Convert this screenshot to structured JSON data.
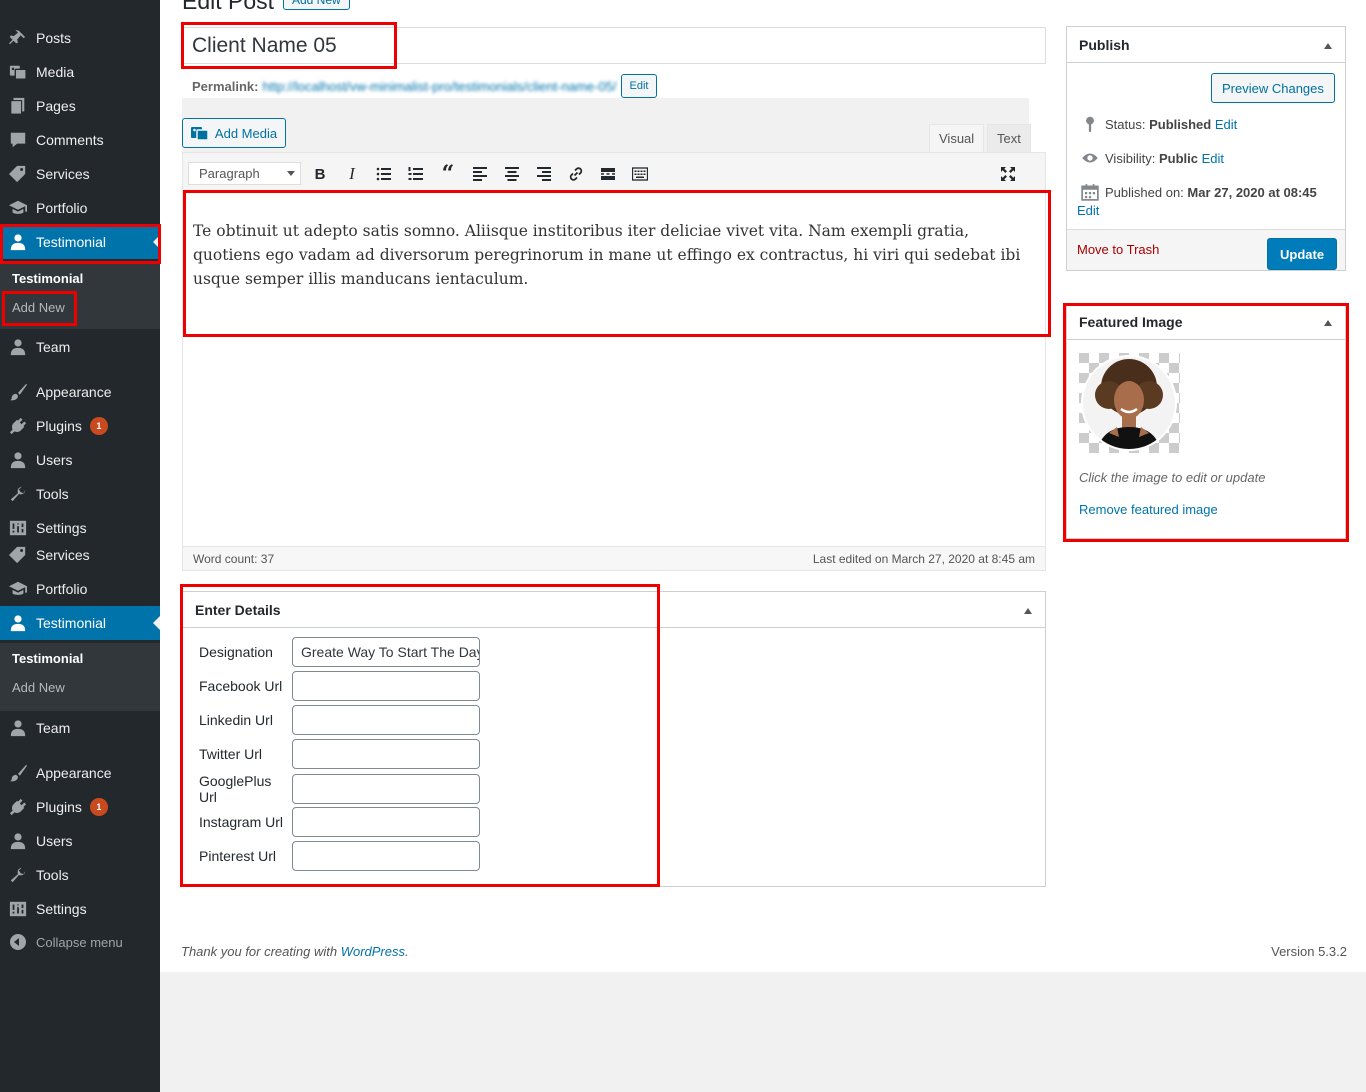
{
  "menu": {
    "group1": [
      {
        "label": "Posts",
        "icon": "pin-icon"
      },
      {
        "label": "Media",
        "icon": "media-icon"
      },
      {
        "label": "Pages",
        "icon": "pages-icon"
      },
      {
        "label": "Comments",
        "icon": "comment-icon"
      },
      {
        "label": "Services",
        "icon": "tag-icon"
      },
      {
        "label": "Portfolio",
        "icon": "portfolio-icon"
      },
      {
        "label": "Testimonial",
        "icon": "user-icon"
      }
    ],
    "submenu1": {
      "title": "Testimonial",
      "add_new": "Add New"
    },
    "group2": [
      {
        "label": "Team",
        "icon": "user-icon"
      },
      {
        "label": "Appearance",
        "icon": "brush-icon"
      },
      {
        "label": "Plugins",
        "icon": "plugin-icon",
        "badge": "1"
      },
      {
        "label": "Users",
        "icon": "user-icon"
      },
      {
        "label": "Tools",
        "icon": "wrench-icon"
      },
      {
        "label": "Settings",
        "icon": "settings-icon"
      },
      {
        "label": "Services",
        "icon": "tag-icon"
      },
      {
        "label": "Portfolio",
        "icon": "portfolio-icon"
      },
      {
        "label": "Testimonial",
        "icon": "user-icon"
      }
    ],
    "submenu2": {
      "title": "Testimonial",
      "add_new": "Add New"
    },
    "group3": [
      {
        "label": "Team",
        "icon": "user-icon"
      },
      {
        "label": "Appearance",
        "icon": "brush-icon"
      },
      {
        "label": "Plugins",
        "icon": "plugin-icon",
        "badge": "1"
      },
      {
        "label": "Users",
        "icon": "user-icon"
      },
      {
        "label": "Tools",
        "icon": "wrench-icon"
      },
      {
        "label": "Settings",
        "icon": "settings-icon"
      }
    ],
    "collapse": "Collapse menu"
  },
  "page": {
    "heading": "Edit Post",
    "add_new": "Add New",
    "title_value": "Client Name 05",
    "permalink_label": "Permalink:",
    "permalink_url": "http://localhost/vw-minimalist-pro/testimonials/client-name-05/",
    "permalink_edit": "Edit"
  },
  "editor": {
    "add_media": "Add Media",
    "tab_visual": "Visual",
    "tab_text": "Text",
    "format": "Paragraph",
    "content": "Te obtinuit ut adepto satis somno. Aliisque institoribus iter deliciae vivet vita. Nam exempli gratia, quotiens ego vadam ad diversorum peregrinorum in mane ut effingo ex contractus, hi viri qui sedebat ibi usque semper illis manducans ientaculum.",
    "word_count": "Word count: 37",
    "last_edited": "Last edited on March 27, 2020 at 8:45 am"
  },
  "details": {
    "title": "Enter Details",
    "fields": [
      {
        "label": "Designation",
        "value": "Greate Way To Start The Day"
      },
      {
        "label": "Facebook Url",
        "value": ""
      },
      {
        "label": "Linkedin Url",
        "value": ""
      },
      {
        "label": "Twitter Url",
        "value": ""
      },
      {
        "label": "GooglePlus Url",
        "value": ""
      },
      {
        "label": "Instagram Url",
        "value": ""
      },
      {
        "label": "Pinterest Url",
        "value": ""
      }
    ]
  },
  "publish": {
    "title": "Publish",
    "preview": "Preview Changes",
    "status_label": "Status:",
    "status_value": "Published",
    "visibility_label": "Visibility:",
    "visibility_value": "Public",
    "published_label": "Published on:",
    "published_value": "Mar 27, 2020 at 08:45",
    "edit": "Edit",
    "trash": "Move to Trash",
    "update": "Update"
  },
  "featured": {
    "title": "Featured Image",
    "hint": "Click the image to edit or update",
    "remove": "Remove featured image"
  },
  "footer": {
    "thanks_prefix": "Thank you for creating with ",
    "wordpress": "WordPress",
    "thanks_suffix": ".",
    "version": "Version 5.3.2"
  },
  "colors": {
    "menu_bg": "#23282d",
    "menu_current": "#0073aa",
    "accent": "#0073aa",
    "highlight": "#e00000",
    "trash": "#a00"
  }
}
